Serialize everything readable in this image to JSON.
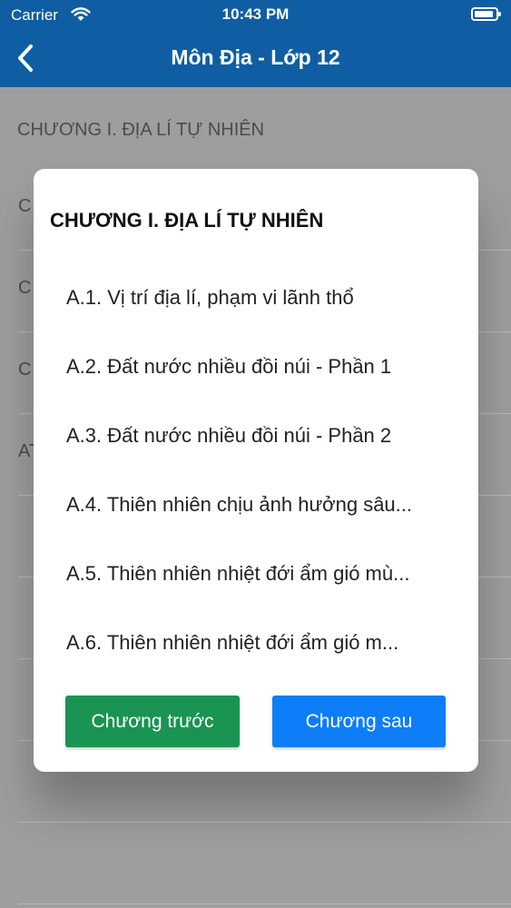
{
  "status_bar": {
    "carrier": "Carrier",
    "time": "10:43 PM",
    "battery_level": 0.9
  },
  "nav": {
    "title": "Môn Địa - Lớp 12"
  },
  "background_list": {
    "header": "CHƯƠNG I. ĐỊA LÍ TỰ NHIÊN",
    "rows": [
      "C",
      "C",
      "C",
      "AT",
      "",
      "",
      "",
      "",
      ""
    ]
  },
  "modal": {
    "title": "CHƯƠNG I. ĐỊA LÍ TỰ NHIÊN",
    "lessons": [
      "A.1. Vị trí địa lí, phạm vi lãnh thổ",
      "A.2. Đất nước nhiều đồi núi - Phần 1",
      "A.3. Đất nước nhiều đồi núi - Phần 2",
      "A.4. Thiên nhiên chịu ảnh hưởng sâu...",
      "A.5. Thiên nhiên nhiệt đới ẩm gió mù...",
      "A.6. Thiên nhiên nhiệt đới ẩm gió m..."
    ],
    "prev_label": "Chương trước",
    "next_label": "Chương sau"
  },
  "colors": {
    "nav_bg": "#0f5ea3",
    "prev_button": "#1a9452",
    "next_button": "#0d7ef7"
  }
}
